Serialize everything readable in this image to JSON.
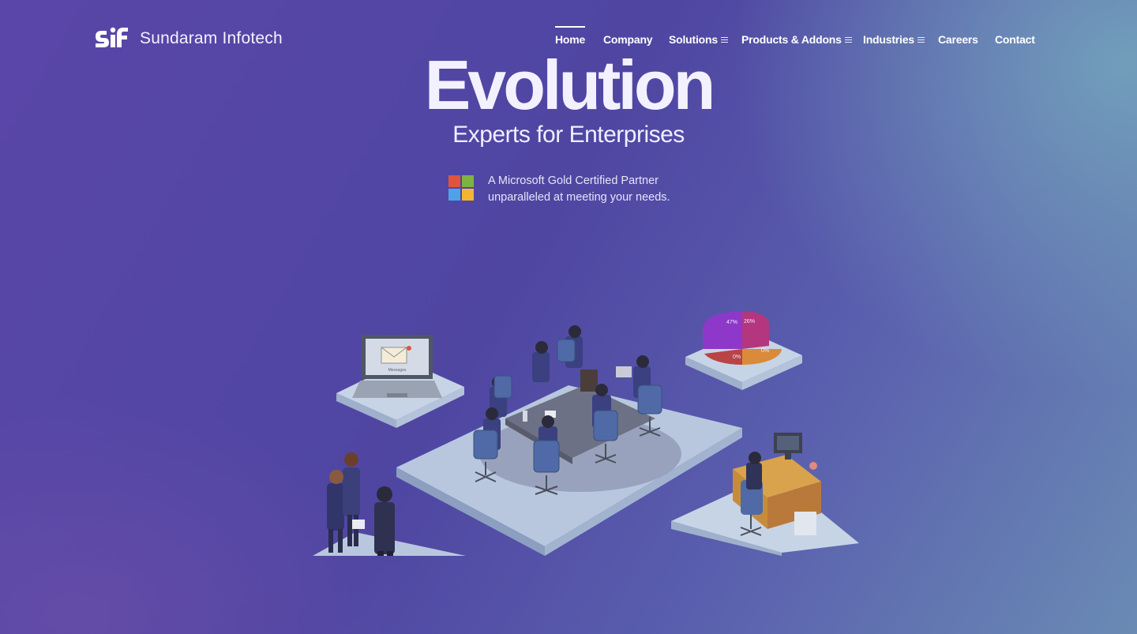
{
  "brand": {
    "name": "Sundaram Infotech",
    "logo_letters": "sif"
  },
  "nav": {
    "items": [
      {
        "label": "Home",
        "active": true,
        "has_menu": false
      },
      {
        "label": "Company",
        "active": false,
        "has_menu": false
      },
      {
        "label": "Solutions",
        "active": false,
        "has_menu": true
      },
      {
        "label": "Products & Addons",
        "active": false,
        "has_menu": true
      },
      {
        "label": "Industries",
        "active": false,
        "has_menu": true
      },
      {
        "label": "Careers",
        "active": false,
        "has_menu": false
      },
      {
        "label": "Contact",
        "active": false,
        "has_menu": false
      }
    ]
  },
  "hero": {
    "title": "Evolution",
    "subtitle": "Experts for Enterprises",
    "partner_line1": "A Microsoft Gold Certified Partner",
    "partner_line2": "unparalleled at meeting your needs."
  },
  "illustration": {
    "laptop_label": "Messages",
    "pie_labels": [
      "47%",
      "26%",
      "0%",
      "0%"
    ]
  },
  "colors": {
    "ms_red": "#e0553a",
    "ms_green": "#7cb342",
    "ms_blue": "#4ea3e8",
    "ms_yellow": "#f2b632",
    "pie_purple": "#8e38c9",
    "pie_magenta": "#b4367e",
    "pie_red": "#b84446",
    "pie_orange": "#d98a3a"
  }
}
